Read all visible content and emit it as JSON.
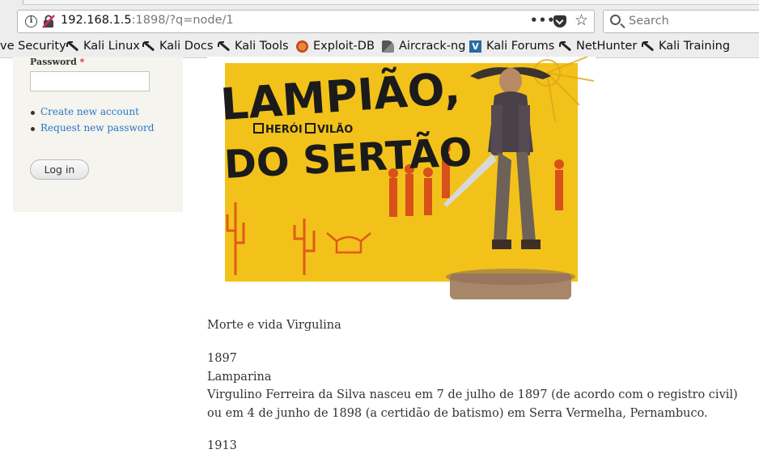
{
  "browser": {
    "url_host": "192.168.1.5",
    "url_rest": ":1898/?q=node/1",
    "search_placeholder": "Search",
    "bookmarks": [
      {
        "label": "ve Security",
        "icon": "none"
      },
      {
        "label": "Kali Linux",
        "icon": "kali-dragon-icon"
      },
      {
        "label": "Kali Docs",
        "icon": "kali-dragon-icon"
      },
      {
        "label": "Kali Tools",
        "icon": "kali-dragon-icon"
      },
      {
        "label": "Exploit-DB",
        "icon": "exploit-db-icon"
      },
      {
        "label": "Aircrack-ng",
        "icon": "aircrack-icon"
      },
      {
        "label": "Kali Forums",
        "icon": "kali-forums-icon"
      },
      {
        "label": "NetHunter",
        "icon": "kali-dragon-icon"
      },
      {
        "label": "Kali Training",
        "icon": "kali-dragon-icon"
      }
    ]
  },
  "login": {
    "password_label": "Password",
    "required_marker": "*",
    "links": [
      "Create new account",
      "Request new password"
    ],
    "button": "Log in"
  },
  "poster": {
    "title_line1": "LAMPIÃO,",
    "option1": "HERÓI",
    "option2": "VILÃO",
    "title_line2": "DO SERTÃO"
  },
  "article": {
    "heading": "Morte e vida Virgulina",
    "year1": "1897",
    "name": "Lamparina",
    "paragraph": "Virgulino Ferreira da Silva nasceu em 7 de julho de 1897 (de acordo com o registro civil) ou em 4 de junho de 1898 (a certidão de batismo) em Serra Vermelha, Pernambuco.",
    "year2": "1913"
  },
  "colors": {
    "link": "#2776c3",
    "required": "#e4282f",
    "poster_yellow": "#f2c21a",
    "sidebar_bg": "#f5f4ef"
  }
}
